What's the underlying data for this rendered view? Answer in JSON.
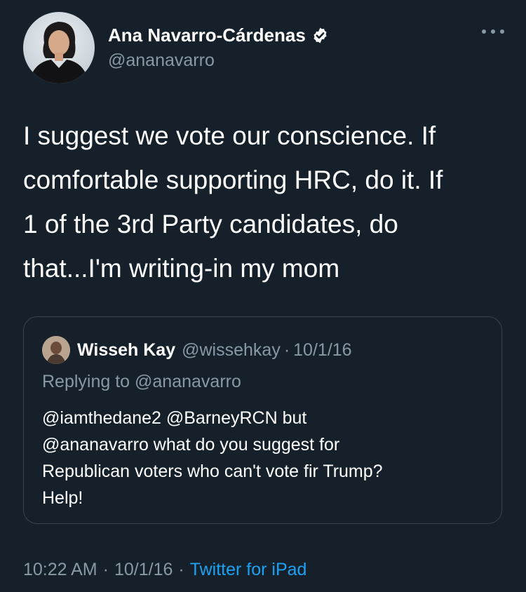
{
  "author": {
    "display_name": "Ana Navarro-Cárdenas",
    "handle": "@ananavarro",
    "verified": true
  },
  "tweet": {
    "text": "I suggest we vote our conscience. If\ncomfortable supporting HRC, do it. If\n1 of the 3rd Party candidates, do\nthat...I'm writing-in my mom"
  },
  "quoted_tweet": {
    "display_name": "Wisseh Kay",
    "handle": "@wissehkay",
    "separator": "·",
    "date": "10/1/16",
    "replying_to": "Replying to @ananavarro",
    "text": "@iamthedane2 @BarneyRCN but\n@ananavarro what do you suggest for\nRepublican voters who can't vote fir Trump?\nHelp!"
  },
  "meta": {
    "time": "10:22 AM",
    "separator": "·",
    "date": "10/1/16",
    "source": "Twitter for iPad"
  },
  "icons": {
    "verified": "verified-badge-icon",
    "more": "more-options-icon"
  },
  "colors": {
    "background": "#15202b",
    "secondary_text": "#8899a6",
    "link": "#1da1f2",
    "border": "#38444d"
  }
}
